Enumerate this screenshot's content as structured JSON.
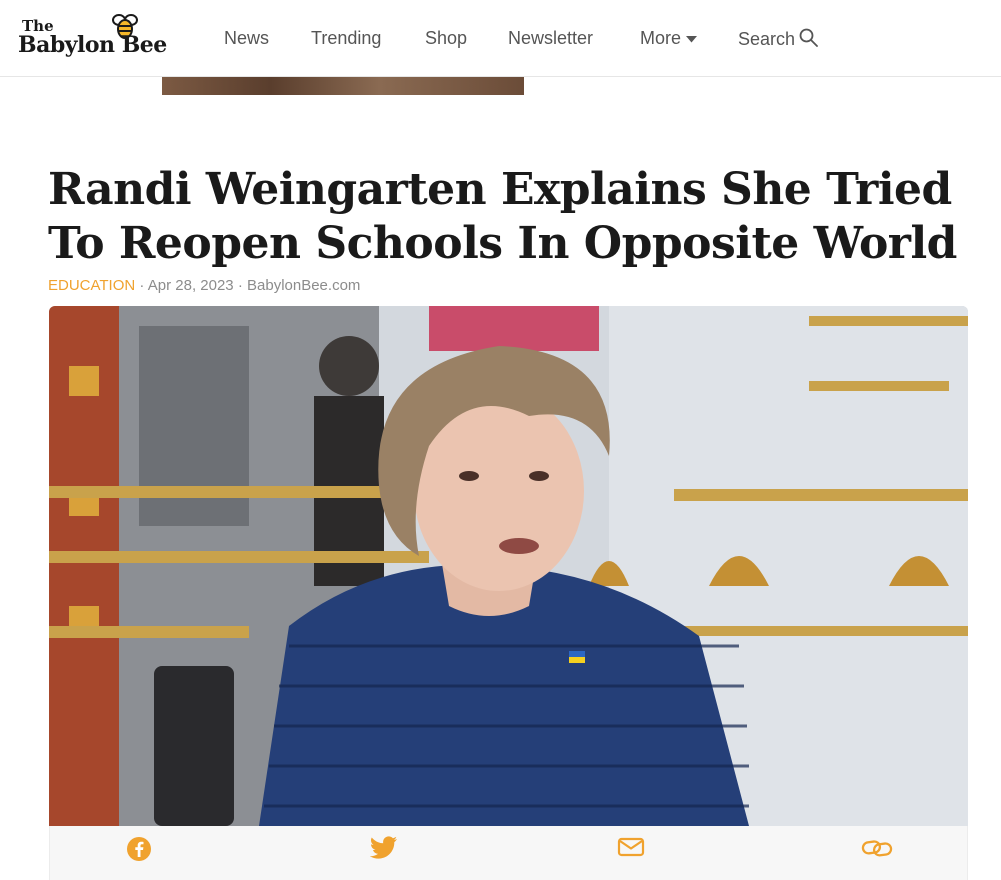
{
  "header": {
    "logo": {
      "the": "The",
      "name": "Babylon Bee"
    },
    "nav": [
      {
        "label": "News"
      },
      {
        "label": "Trending"
      },
      {
        "label": "Shop"
      },
      {
        "label": "Newsletter"
      },
      {
        "label": "More",
        "icon": "caret-down-icon"
      },
      {
        "label": "Search",
        "icon": "search-icon"
      }
    ]
  },
  "article": {
    "title": "Randi Weingarten Explains She Tried To Reopen Schools In Opposite World",
    "category": "EDUCATION",
    "separator": "·",
    "date": "Apr 28, 2023",
    "source": "BabylonBee.com"
  },
  "share": {
    "icons": [
      "facebook-icon",
      "twitter-icon",
      "email-icon",
      "link-icon"
    ]
  },
  "colors": {
    "accent": "#f0a22e",
    "nav_text": "#555555",
    "headline": "#1a1a1a",
    "meta_text": "#8c8c8c",
    "share_bg": "#f7f7f7"
  }
}
